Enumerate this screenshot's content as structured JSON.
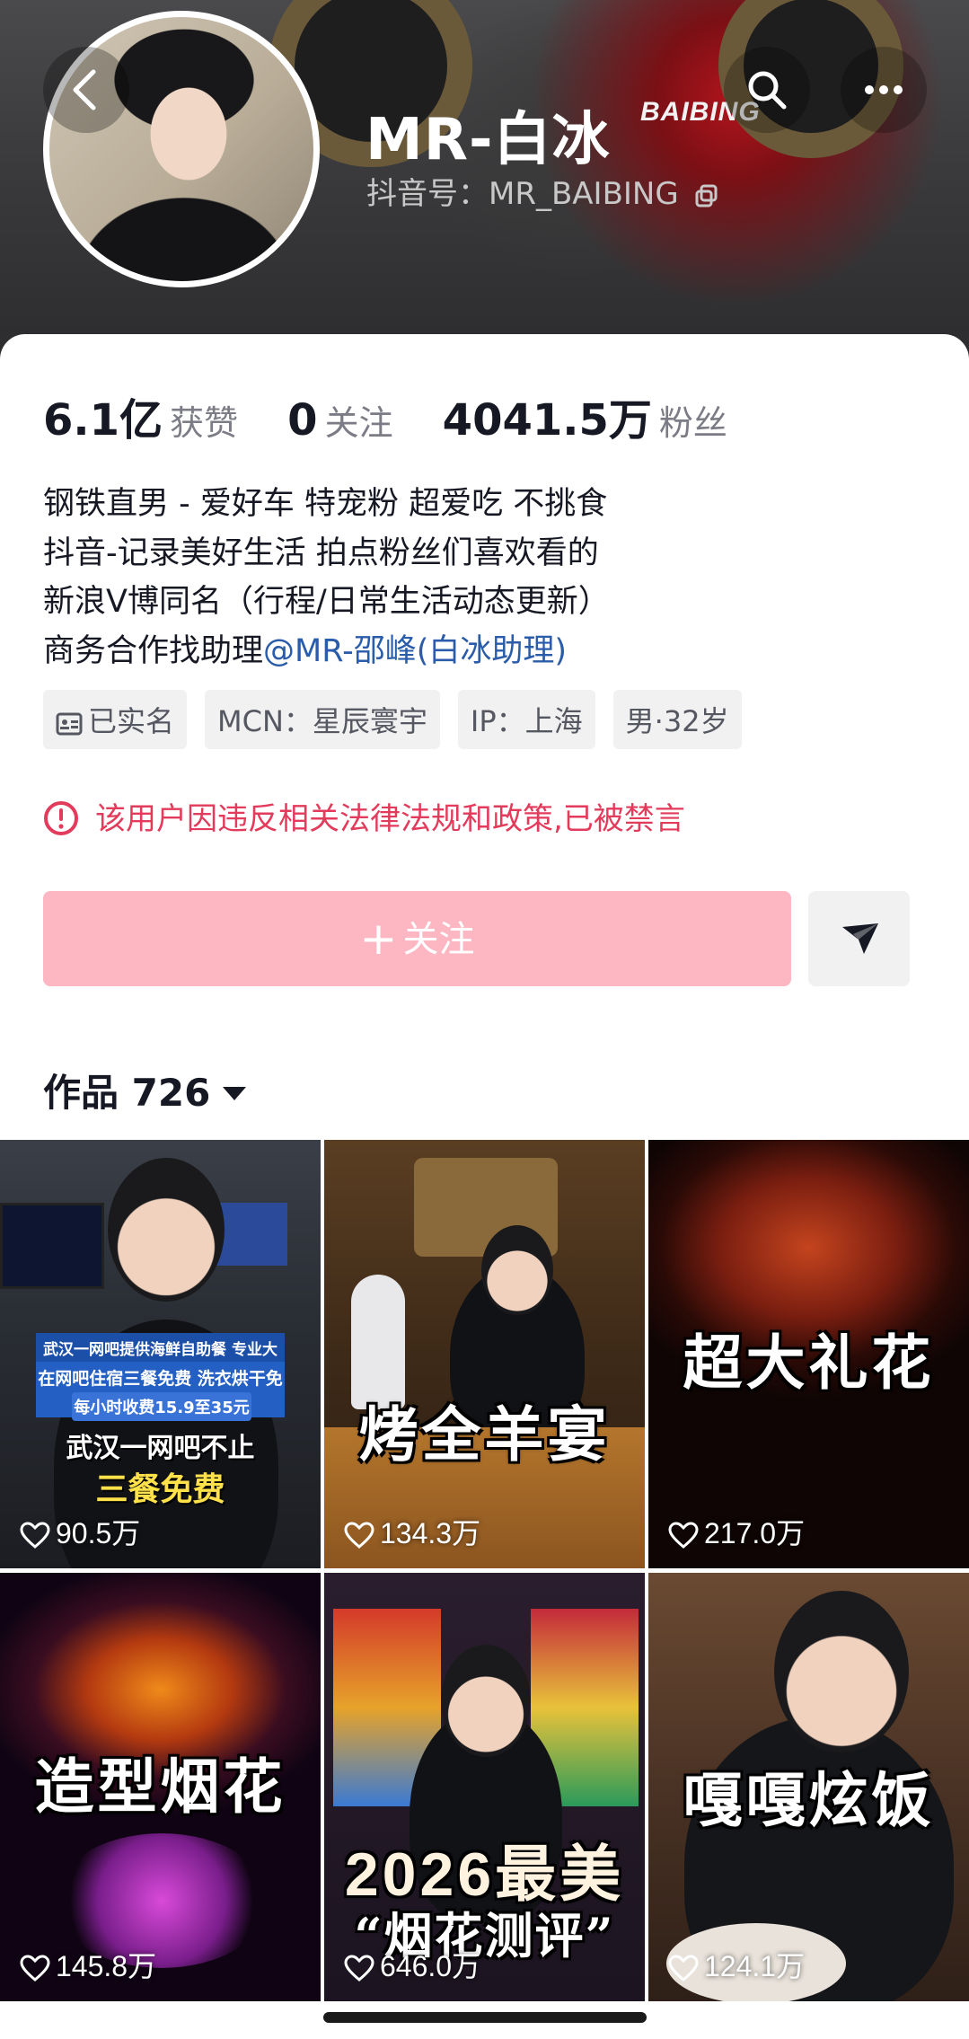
{
  "profile": {
    "name": "MR-白冰",
    "douyin_id": "抖音号：MR_BAIBING",
    "cover_bike_text": "BAIBING"
  },
  "stats": [
    {
      "value": "6.1亿",
      "label": "获赞"
    },
    {
      "value": "0",
      "label": "关注"
    },
    {
      "value": "4041.5万",
      "label": "粉丝"
    }
  ],
  "bio": {
    "line1": "钢铁直男 - 爱好车 特宠粉 超爱吃 不挑食",
    "line2": "抖音-记录美好生活 拍点粉丝们喜欢看的",
    "line3": "新浪V博同名（行程/日常生活动态更新）",
    "line4_prefix": "商务合作找助理",
    "line4_mention": "@MR-邵峰(白冰助理)"
  },
  "tags": {
    "verified": "已实名",
    "mcn": "MCN：星辰寰宇",
    "ip": "IP：上海",
    "gender_age": "男·32岁"
  },
  "ban_notice": "该用户因违反相关法律法规和政策,已被禁言",
  "actions": {
    "follow_plus": "+",
    "follow_label": "关注"
  },
  "works": {
    "label": "作品 726"
  },
  "videos": [
    {
      "caption": "",
      "likes": "90.5万",
      "overlay": {
        "banner1": "武汉一网吧提供海鲜自助餐 专业大厨现做",
        "banner2": "在网吧住宿三餐免费 洗衣烘干免费",
        "banner3": "每小时收费15.9至35元",
        "text1": "武汉一网吧不止",
        "text2": "三餐免费"
      }
    },
    {
      "caption": "烤全羊宴",
      "likes": "134.3万"
    },
    {
      "caption": "超大礼花",
      "likes": "217.0万"
    },
    {
      "caption": "造型烟花",
      "likes": "145.8万"
    },
    {
      "caption": "2026最美",
      "caption2": "“烟花测评”",
      "likes": "646.0万"
    },
    {
      "caption": "嘎嘎炫饭",
      "likes": "124.1万"
    }
  ],
  "colors": {
    "ban_red": "#e33b5b",
    "follow_pink": "#fdb7c3",
    "mention_blue": "#2a5caa"
  },
  "icons": [
    "back-arrow-icon",
    "search-icon",
    "more-icon",
    "copy-icon",
    "id-card-icon",
    "warning-icon",
    "send-icon",
    "heart-icon",
    "caret-down-icon"
  ]
}
